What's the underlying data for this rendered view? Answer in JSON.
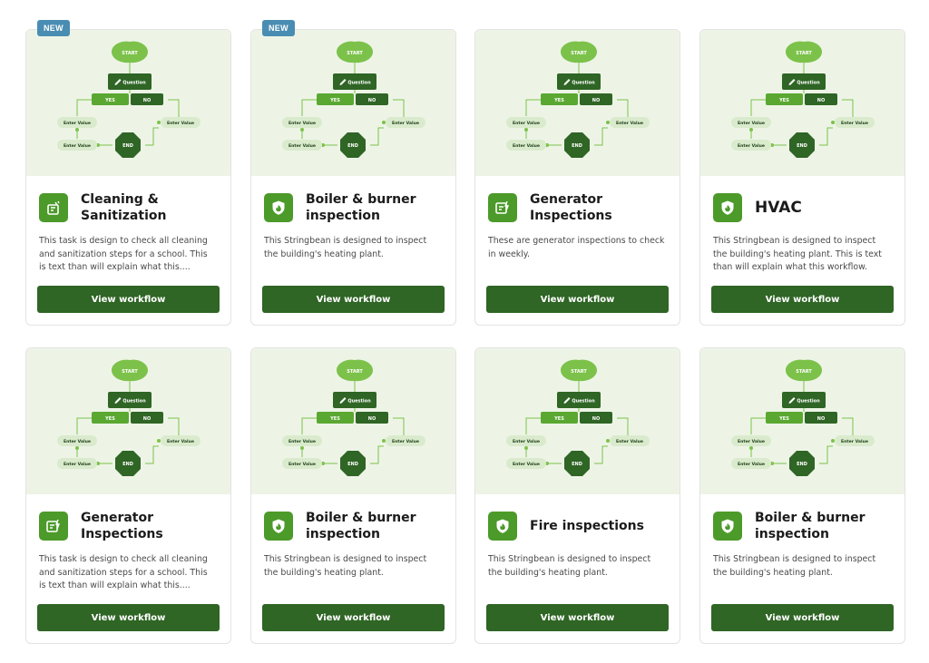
{
  "flow": {
    "start": "START",
    "question": "Question",
    "yes": "YES",
    "no": "NO",
    "enter_value": "Enter Value",
    "end": "END"
  },
  "colors": {
    "accent": "#4c9a2a",
    "button": "#2f6525",
    "badge": "#4a8db3",
    "thumb_bg": "#edf4e6"
  },
  "cards": [
    {
      "badge": "NEW",
      "icon": "cleaning-icon",
      "title": "Cleaning & Sanitization",
      "description": "This task is design to check all cleaning and sanitization steps for a school. This is text than will explain what this....",
      "button": "View workflow"
    },
    {
      "badge": "NEW",
      "icon": "flame-shield-icon",
      "title": "Boiler & burner inspection",
      "description": "This Stringbean is designed to inspect the building's heating plant.",
      "button": "View workflow"
    },
    {
      "badge": "",
      "icon": "generator-icon",
      "title": "Generator Inspections",
      "description": "These are generator inspections to check in weekly.",
      "button": "View workflow"
    },
    {
      "badge": "",
      "icon": "flame-shield-icon",
      "title": "HVAC",
      "description": "This Stringbean is designed to inspect the building's heating plant. This is text than will explain what this workflow.",
      "button": "View workflow"
    },
    {
      "badge": "",
      "icon": "generator-icon",
      "title": "Generator Inspections",
      "description": "This task is design to check all cleaning and sanitization steps for a school. This is text than will explain what this....",
      "button": "View workflow"
    },
    {
      "badge": "",
      "icon": "flame-shield-icon",
      "title": "Boiler & burner inspection",
      "description": "This Stringbean is designed to inspect the building's heating plant.",
      "button": "View workflow"
    },
    {
      "badge": "",
      "icon": "flame-shield-icon",
      "title": "Fire inspections",
      "description": "This Stringbean is designed to inspect the building's heating plant.",
      "button": "View workflow"
    },
    {
      "badge": "",
      "icon": "flame-shield-icon",
      "title": "Boiler & burner inspection",
      "description": "This Stringbean is designed to inspect the building's heating plant.",
      "button": "View workflow"
    }
  ]
}
